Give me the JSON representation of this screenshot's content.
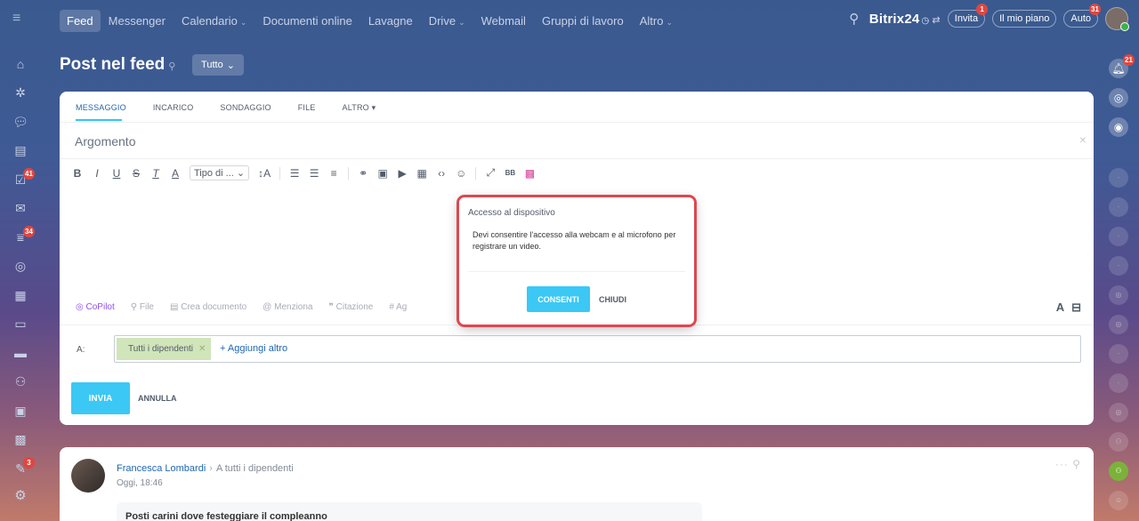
{
  "topnav": {
    "items": [
      {
        "label": "Feed",
        "active": true,
        "dropdown": false
      },
      {
        "label": "Messenger",
        "active": false,
        "dropdown": false
      },
      {
        "label": "Calendario",
        "active": false,
        "dropdown": true
      },
      {
        "label": "Documenti online",
        "active": false,
        "dropdown": false
      },
      {
        "label": "Lavagne",
        "active": false,
        "dropdown": false
      },
      {
        "label": "Drive",
        "active": false,
        "dropdown": true
      },
      {
        "label": "Webmail",
        "active": false,
        "dropdown": false
      },
      {
        "label": "Gruppi di lavoro",
        "active": false,
        "dropdown": false
      },
      {
        "label": "Altro",
        "active": false,
        "dropdown": true
      }
    ],
    "brand": "Bitrix24",
    "invite_label": "Invita",
    "invite_badge": "1",
    "plan_label": "Il mio piano",
    "auto_label": "Auto",
    "auto_badge": "31"
  },
  "leftbar": {
    "badges": {
      "tasks": "41",
      "feed": "34",
      "approvals": "3"
    }
  },
  "rightbar": {
    "notifications_badge": "21"
  },
  "page": {
    "title": "Post nel feed",
    "filter_label": "Tutto"
  },
  "composer": {
    "tabs": [
      "MESSAGGIO",
      "INCARICO",
      "SONDAGGIO",
      "FILE",
      "ALTRO"
    ],
    "subject_placeholder": "Argomento",
    "font_select": "Tipo di ...",
    "attach_items": [
      "CoPilot",
      "File",
      "Crea documento",
      "Menziona",
      "Citazione",
      "Ag"
    ],
    "to_label": "A:",
    "recipient": "Tutti i dipendenti",
    "add_more": "+ Aggiungi altro",
    "send_label": "INVIA",
    "cancel_label": "ANNULLA"
  },
  "post": {
    "author": "Francesca Lombardi",
    "recipient": "A tutti i dipendenti",
    "date": "Oggi, 18:46",
    "preview": "Posti carini dove festeggiare il compleanno"
  },
  "modal": {
    "title": "Accesso al dispositivo",
    "text": "Devi consentire l'accesso alla webcam e al microfono per registrare un video.",
    "ok_label": "CONSENTI",
    "close_label": "CHIUDI"
  },
  "colors": {
    "accent": "#3bc8f5",
    "link": "#2067b0",
    "highlight": "#e0464f",
    "badge": "#e0463f"
  }
}
